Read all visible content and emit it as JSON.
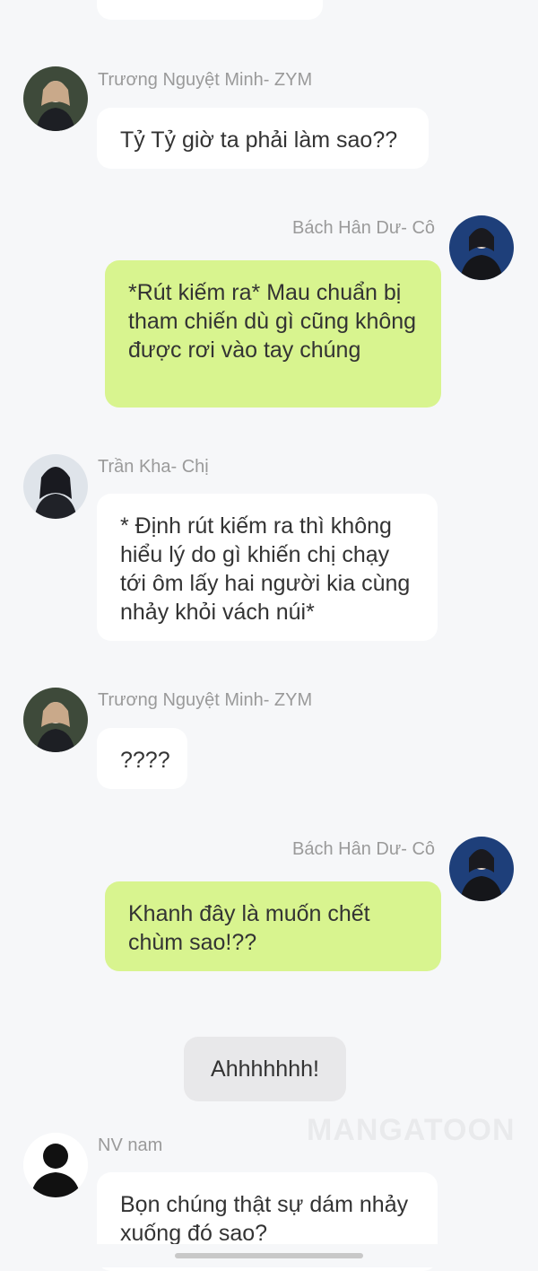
{
  "messages": [
    {
      "sender": "",
      "text": "",
      "side": "left",
      "partial": true
    },
    {
      "sender": "Trương Nguyệt Minh- ZYM",
      "text": "Tỷ Tỷ giờ ta phải làm sao??",
      "side": "left",
      "avatar": "female-character-avatar-icon"
    },
    {
      "sender": "Bách Hân Dư- Cô",
      "text": "*Rút kiếm ra* Mau chuẩn bị tham chiến dù gì cũng không được rơi vào tay chúng",
      "side": "right",
      "avatar": "female-character-avatar-icon"
    },
    {
      "sender": "Trần Kha- Chị",
      "text": "* Định rút kiếm ra thì không hiểu lý do gì khiến chị chạy tới ôm lấy hai người kia cùng nhảy khỏi vách núi*",
      "side": "left",
      "avatar": "female-character-avatar-icon"
    },
    {
      "sender": "Trương Nguyệt Minh- ZYM",
      "text": "????",
      "side": "left",
      "avatar": "female-character-avatar-icon"
    },
    {
      "sender": "Bách Hân Dư- Cô",
      "text": "Khanh đây là muốn chết chùm sao!??",
      "side": "right",
      "avatar": "female-character-avatar-icon"
    },
    {
      "sender": "",
      "text": "Ahhhhhhh!",
      "side": "center",
      "type": "narration"
    },
    {
      "sender": "NV nam",
      "text": "Bọn chúng thật sự dám nhảy xuống đó sao?",
      "side": "left",
      "avatar": "male-silhouette-avatar-icon"
    }
  ],
  "watermark": "MANGATOON",
  "colors": {
    "background": "#f6f7f9",
    "bubble_incoming": "#ffffff",
    "bubble_outgoing": "#d8f48f",
    "bubble_narration": "#e8e8ea",
    "sender_name": "#9a9a9a"
  }
}
